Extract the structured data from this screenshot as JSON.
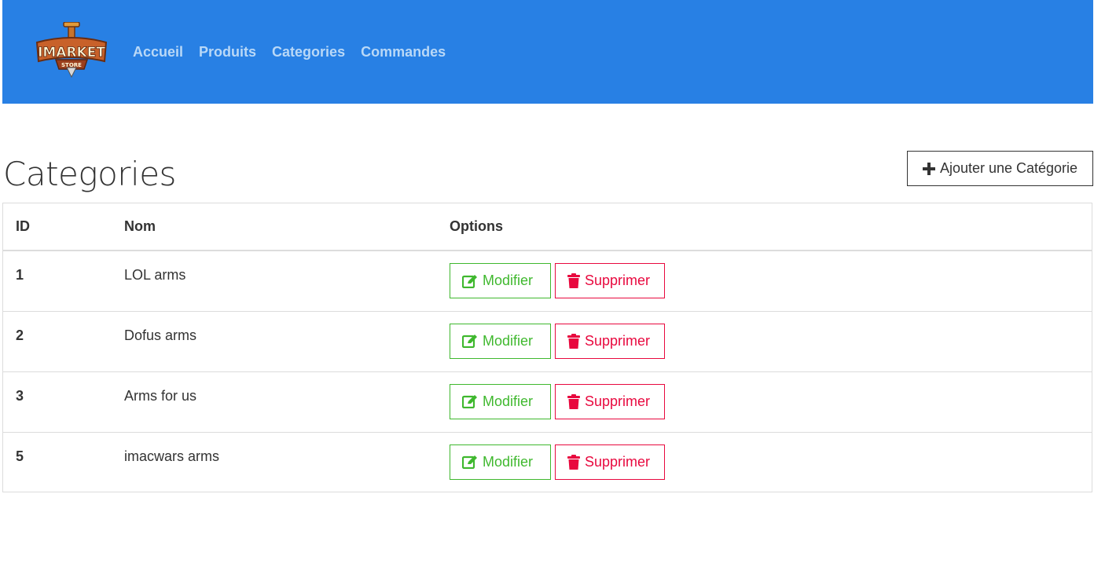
{
  "brand": {
    "logo_text": "IMARKET",
    "logo_subtext": "STORE"
  },
  "nav": {
    "items": [
      {
        "label": "Accueil"
      },
      {
        "label": "Produits"
      },
      {
        "label": "Categories"
      },
      {
        "label": "Commandes"
      }
    ]
  },
  "page": {
    "title": "Categories",
    "add_button_label": "Ajouter une Catégorie",
    "add_button_icon": "plus-icon"
  },
  "table": {
    "headers": {
      "id": "ID",
      "name": "Nom",
      "options": "Options"
    },
    "rows": [
      {
        "id": "1",
        "name": "LOL arms"
      },
      {
        "id": "2",
        "name": "Dofus arms"
      },
      {
        "id": "3",
        "name": "Arms for us"
      },
      {
        "id": "5",
        "name": "imacwars arms"
      }
    ],
    "edit_label": "Modifier",
    "edit_icon": "edit-icon",
    "delete_label": "Supprimer",
    "delete_icon": "trash-icon"
  },
  "colors": {
    "navbar": "#2880e4",
    "nav_link": "#b9d8f7",
    "edit": "#3fb82e",
    "delete": "#e8083e"
  }
}
